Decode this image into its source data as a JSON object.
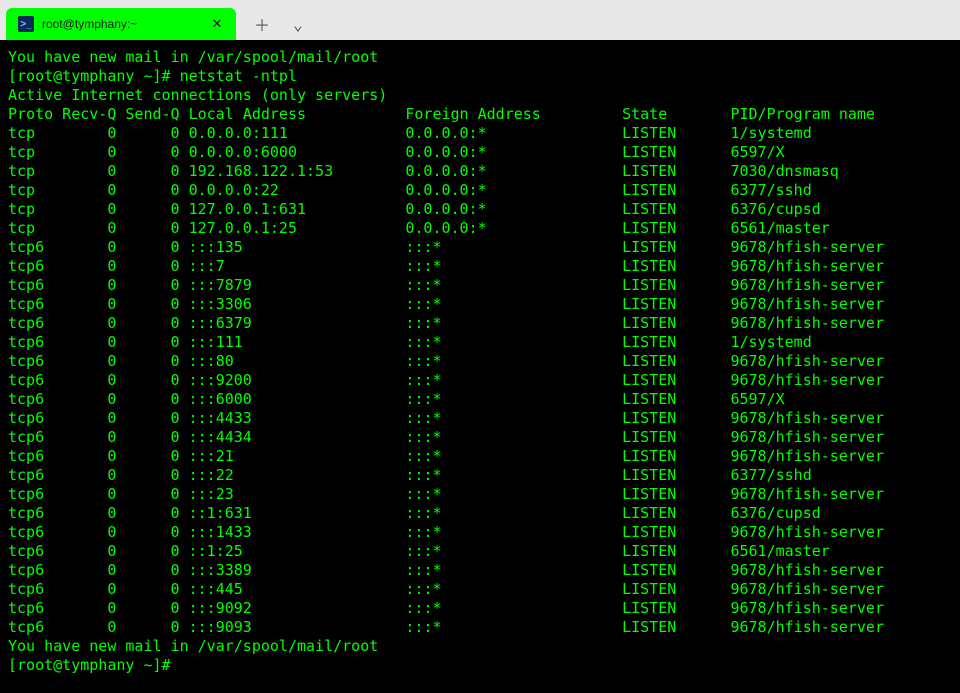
{
  "tab": {
    "title": "root@tymphany:~",
    "icon_glyph": ">_"
  },
  "mail_line": "You have new mail in /var/spool/mail/root",
  "prompt": "[root@tymphany ~]#",
  "command": "netstat -ntpl",
  "header_line": "Active Internet connections (only servers)",
  "columns": {
    "proto": "Proto",
    "recvq": "Recv-Q",
    "sendq": "Send-Q",
    "local": "Local Address",
    "foreign": "Foreign Address",
    "state": "State",
    "pid": "PID/Program name"
  },
  "rows": [
    {
      "proto": "tcp",
      "recvq": "0",
      "sendq": "0",
      "local": "0.0.0.0:111",
      "foreign": "0.0.0.0:*",
      "state": "LISTEN",
      "pid": "1/systemd"
    },
    {
      "proto": "tcp",
      "recvq": "0",
      "sendq": "0",
      "local": "0.0.0.0:6000",
      "foreign": "0.0.0.0:*",
      "state": "LISTEN",
      "pid": "6597/X"
    },
    {
      "proto": "tcp",
      "recvq": "0",
      "sendq": "0",
      "local": "192.168.122.1:53",
      "foreign": "0.0.0.0:*",
      "state": "LISTEN",
      "pid": "7030/dnsmasq"
    },
    {
      "proto": "tcp",
      "recvq": "0",
      "sendq": "0",
      "local": "0.0.0.0:22",
      "foreign": "0.0.0.0:*",
      "state": "LISTEN",
      "pid": "6377/sshd"
    },
    {
      "proto": "tcp",
      "recvq": "0",
      "sendq": "0",
      "local": "127.0.0.1:631",
      "foreign": "0.0.0.0:*",
      "state": "LISTEN",
      "pid": "6376/cupsd"
    },
    {
      "proto": "tcp",
      "recvq": "0",
      "sendq": "0",
      "local": "127.0.0.1:25",
      "foreign": "0.0.0.0:*",
      "state": "LISTEN",
      "pid": "6561/master"
    },
    {
      "proto": "tcp6",
      "recvq": "0",
      "sendq": "0",
      "local": ":::135",
      "foreign": ":::*",
      "state": "LISTEN",
      "pid": "9678/hfish-server"
    },
    {
      "proto": "tcp6",
      "recvq": "0",
      "sendq": "0",
      "local": ":::7",
      "foreign": ":::*",
      "state": "LISTEN",
      "pid": "9678/hfish-server"
    },
    {
      "proto": "tcp6",
      "recvq": "0",
      "sendq": "0",
      "local": ":::7879",
      "foreign": ":::*",
      "state": "LISTEN",
      "pid": "9678/hfish-server"
    },
    {
      "proto": "tcp6",
      "recvq": "0",
      "sendq": "0",
      "local": ":::3306",
      "foreign": ":::*",
      "state": "LISTEN",
      "pid": "9678/hfish-server"
    },
    {
      "proto": "tcp6",
      "recvq": "0",
      "sendq": "0",
      "local": ":::6379",
      "foreign": ":::*",
      "state": "LISTEN",
      "pid": "9678/hfish-server"
    },
    {
      "proto": "tcp6",
      "recvq": "0",
      "sendq": "0",
      "local": ":::111",
      "foreign": ":::*",
      "state": "LISTEN",
      "pid": "1/systemd"
    },
    {
      "proto": "tcp6",
      "recvq": "0",
      "sendq": "0",
      "local": ":::80",
      "foreign": ":::*",
      "state": "LISTEN",
      "pid": "9678/hfish-server"
    },
    {
      "proto": "tcp6",
      "recvq": "0",
      "sendq": "0",
      "local": ":::9200",
      "foreign": ":::*",
      "state": "LISTEN",
      "pid": "9678/hfish-server"
    },
    {
      "proto": "tcp6",
      "recvq": "0",
      "sendq": "0",
      "local": ":::6000",
      "foreign": ":::*",
      "state": "LISTEN",
      "pid": "6597/X"
    },
    {
      "proto": "tcp6",
      "recvq": "0",
      "sendq": "0",
      "local": ":::4433",
      "foreign": ":::*",
      "state": "LISTEN",
      "pid": "9678/hfish-server"
    },
    {
      "proto": "tcp6",
      "recvq": "0",
      "sendq": "0",
      "local": ":::4434",
      "foreign": ":::*",
      "state": "LISTEN",
      "pid": "9678/hfish-server"
    },
    {
      "proto": "tcp6",
      "recvq": "0",
      "sendq": "0",
      "local": ":::21",
      "foreign": ":::*",
      "state": "LISTEN",
      "pid": "9678/hfish-server"
    },
    {
      "proto": "tcp6",
      "recvq": "0",
      "sendq": "0",
      "local": ":::22",
      "foreign": ":::*",
      "state": "LISTEN",
      "pid": "6377/sshd"
    },
    {
      "proto": "tcp6",
      "recvq": "0",
      "sendq": "0",
      "local": ":::23",
      "foreign": ":::*",
      "state": "LISTEN",
      "pid": "9678/hfish-server"
    },
    {
      "proto": "tcp6",
      "recvq": "0",
      "sendq": "0",
      "local": "::1:631",
      "foreign": ":::*",
      "state": "LISTEN",
      "pid": "6376/cupsd"
    },
    {
      "proto": "tcp6",
      "recvq": "0",
      "sendq": "0",
      "local": ":::1433",
      "foreign": ":::*",
      "state": "LISTEN",
      "pid": "9678/hfish-server"
    },
    {
      "proto": "tcp6",
      "recvq": "0",
      "sendq": "0",
      "local": "::1:25",
      "foreign": ":::*",
      "state": "LISTEN",
      "pid": "6561/master"
    },
    {
      "proto": "tcp6",
      "recvq": "0",
      "sendq": "0",
      "local": ":::3389",
      "foreign": ":::*",
      "state": "LISTEN",
      "pid": "9678/hfish-server"
    },
    {
      "proto": "tcp6",
      "recvq": "0",
      "sendq": "0",
      "local": ":::445",
      "foreign": ":::*",
      "state": "LISTEN",
      "pid": "9678/hfish-server"
    },
    {
      "proto": "tcp6",
      "recvq": "0",
      "sendq": "0",
      "local": ":::9092",
      "foreign": ":::*",
      "state": "LISTEN",
      "pid": "9678/hfish-server"
    },
    {
      "proto": "tcp6",
      "recvq": "0",
      "sendq": "0",
      "local": ":::9093",
      "foreign": ":::*",
      "state": "LISTEN",
      "pid": "9678/hfish-server"
    }
  ],
  "mail_line2": "You have new mail in /var/spool/mail/root"
}
